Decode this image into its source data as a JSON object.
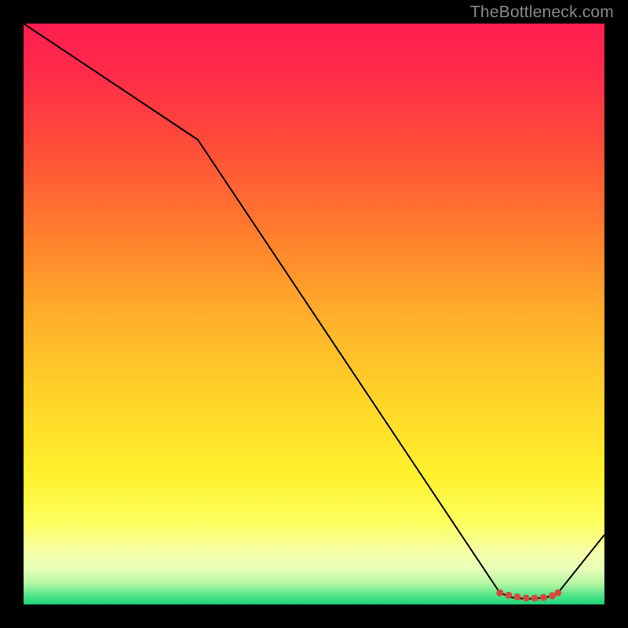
{
  "meta": {
    "watermark": "TheBottleneck.com"
  },
  "chart_data": {
    "type": "line",
    "title": "",
    "xlabel": "",
    "ylabel": "",
    "xlim": [
      0,
      100
    ],
    "ylim": [
      0,
      100
    ],
    "background_gradient": {
      "direction": "vertical",
      "stops": [
        {
          "pos": 0.0,
          "color": "#ff1e50"
        },
        {
          "pos": 0.2,
          "color": "#ff4a3a"
        },
        {
          "pos": 0.5,
          "color": "#ffae2a"
        },
        {
          "pos": 0.78,
          "color": "#fff22e"
        },
        {
          "pos": 0.92,
          "color": "#f0ffb0"
        },
        {
          "pos": 1.0,
          "color": "#1fd47a"
        }
      ]
    },
    "series": [
      {
        "name": "bottleneck-curve",
        "color": "#000000",
        "width": 2,
        "x": [
          0,
          30,
          82,
          84,
          86,
          88,
          90,
          92,
          100
        ],
        "y": [
          100,
          80,
          2,
          1.2,
          1.0,
          1.0,
          1.2,
          2,
          12
        ]
      }
    ],
    "markers": {
      "name": "highlight-cluster",
      "shape": "circle",
      "color": "#d44a3a",
      "radius": 4.5,
      "x": [
        82,
        83.5,
        85,
        86.5,
        88,
        89.5,
        91,
        92
      ],
      "y": [
        2.0,
        1.6,
        1.3,
        1.1,
        1.1,
        1.2,
        1.5,
        2.0
      ]
    }
  }
}
